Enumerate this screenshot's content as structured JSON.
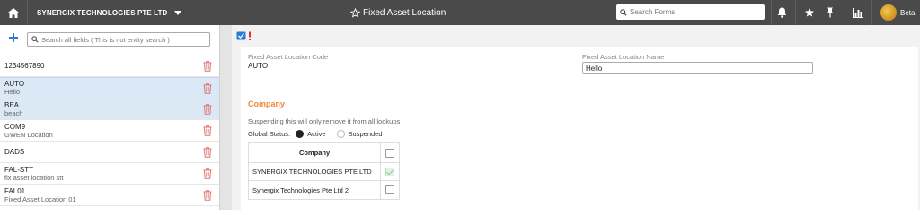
{
  "topbar": {
    "company": "SYNERGIX TECHNOLOGIES PTE LTD",
    "title": "Fixed Asset Location",
    "search_placeholder": "Search Forms",
    "user_label": "Beta"
  },
  "left": {
    "search_placeholder": "Search all fields ( This is not entity search )",
    "items": [
      {
        "code": "1234567890",
        "name": ""
      },
      {
        "code": "AUTO",
        "name": "Hello"
      },
      {
        "code": "BEA",
        "name": "beach"
      },
      {
        "code": "COM9",
        "name": "GWEN Location"
      },
      {
        "code": "DADS",
        "name": ""
      },
      {
        "code": "FAL-STT",
        "name": "fix asset location stt"
      },
      {
        "code": "FAL01",
        "name": "Fixed Asset Location 01"
      }
    ]
  },
  "form": {
    "code_label": "Fixed Asset Location Code",
    "code_value": "AUTO",
    "name_label": "Fixed Asset Location Name",
    "name_value": "Hello",
    "section_title": "Company",
    "note": "Suspending this will only remove it from all lookups",
    "status_label": "Global Status:",
    "status_active": "Active",
    "status_suspended": "Suspended",
    "table": {
      "header": "Company",
      "rows": [
        {
          "name": "SYNERGIX TECHNOLOGIES PTE LTD",
          "checked": true
        },
        {
          "name": "Synergix Technologies Pte Ltd 2",
          "checked": false
        }
      ]
    }
  },
  "colors": {
    "topbar": "#4a4a4a",
    "accent_orange": "#f0883a",
    "selected_row": "#dbe9f6",
    "trash_red": "#e07070",
    "add_blue": "#2a7bd4"
  }
}
